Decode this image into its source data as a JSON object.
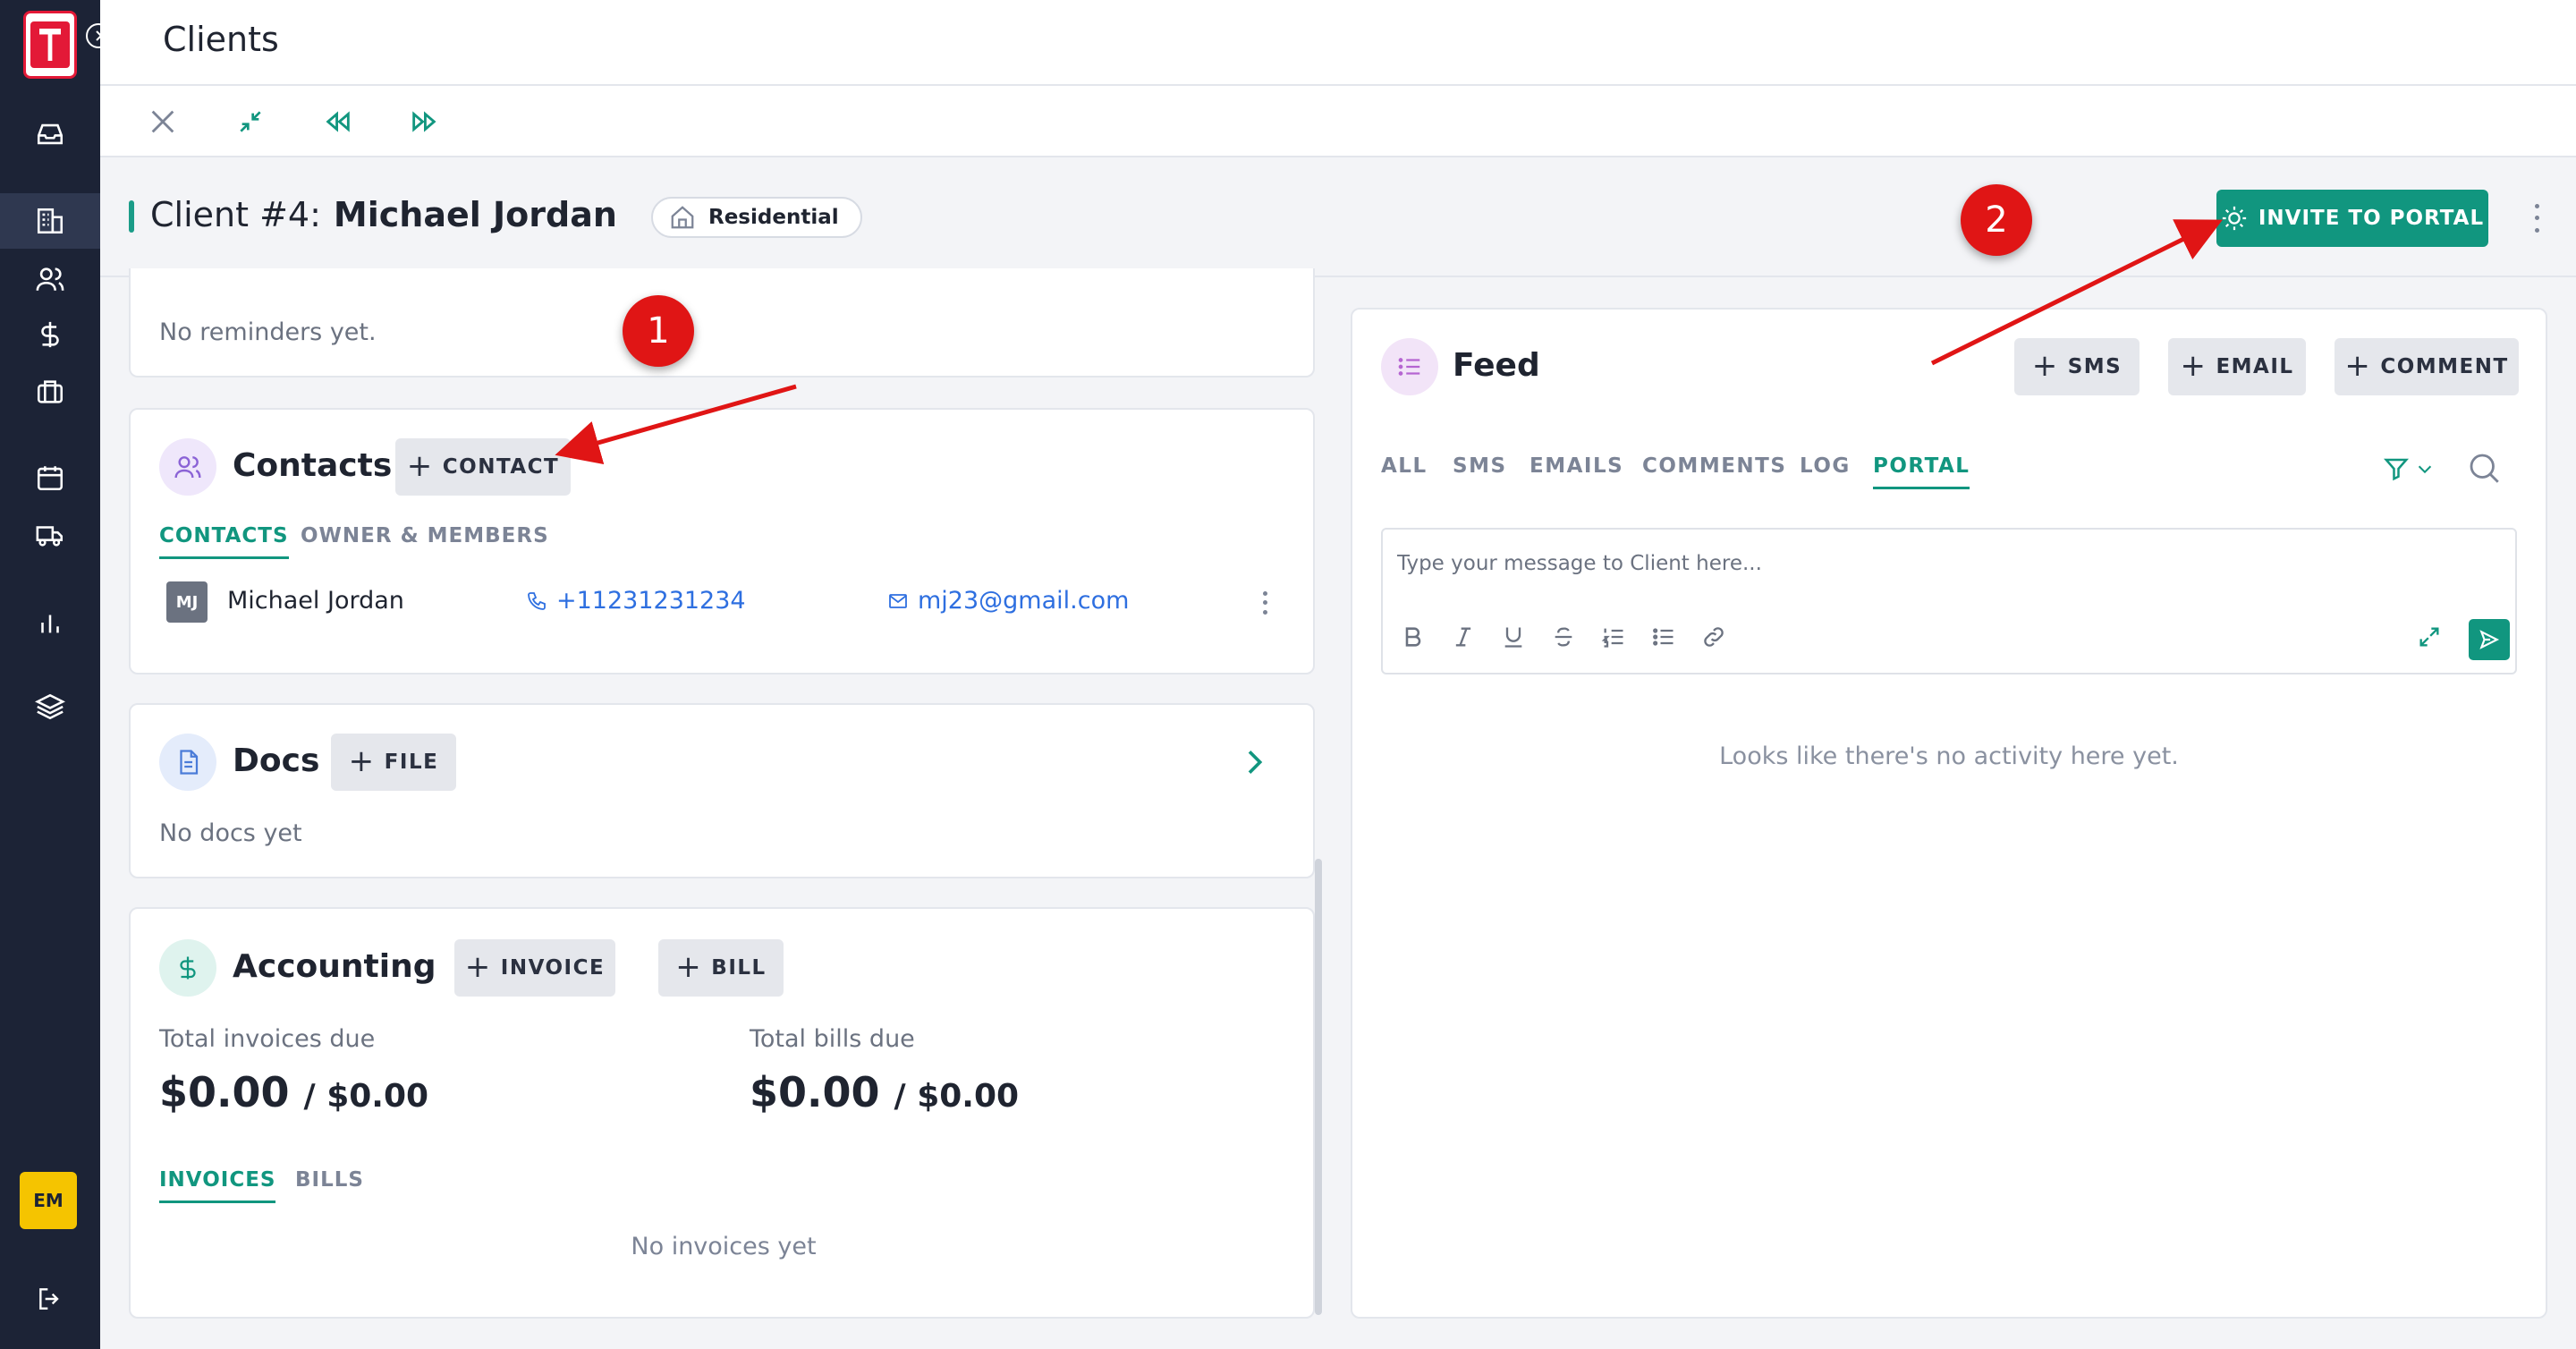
{
  "topbar": {
    "title": "Clients"
  },
  "sidebar": {
    "user_initials": "EM"
  },
  "header": {
    "client_prefix": "Client #4:",
    "client_name": "Michael Jordan",
    "type_badge": "Residential",
    "invite_label": "INVITE TO PORTAL"
  },
  "reminders": {
    "empty_text": "No reminders yet."
  },
  "contacts": {
    "title": "Contacts",
    "add_label": "CONTACT",
    "tabs": [
      "CONTACTS",
      "OWNER & MEMBERS"
    ],
    "rows": [
      {
        "initials": "MJ",
        "name": "Michael Jordan",
        "phone": "+11231231234",
        "email": "mj23@gmail.com"
      }
    ]
  },
  "docs": {
    "title": "Docs",
    "add_label": "FILE",
    "empty_text": "No docs yet"
  },
  "accounting": {
    "title": "Accounting",
    "invoice_label": "INVOICE",
    "bill_label": "BILL",
    "invoices_due_label": "Total invoices due",
    "invoices_due_value": "$0.00",
    "invoices_due_total": "/ $0.00",
    "bills_due_label": "Total bills due",
    "bills_due_value": "$0.00",
    "bills_due_total": "/ $0.00",
    "tabs": [
      "INVOICES",
      "BILLS"
    ],
    "empty_text": "No invoices yet"
  },
  "feed": {
    "title": "Feed",
    "sms_label": "SMS",
    "email_label": "EMAIL",
    "comment_label": "COMMENT",
    "tabs": [
      "ALL",
      "SMS",
      "EMAILS",
      "COMMENTS",
      "LOG",
      "PORTAL"
    ],
    "active_tab": "PORTAL",
    "composer_placeholder": "Type your message to Client here...",
    "empty_text": "Looks like there's no activity here yet."
  },
  "annotations": [
    "1",
    "2"
  ],
  "colors": {
    "accent": "#11967f",
    "sidebar": "#1c2336",
    "annotation": "#e01515",
    "link": "#2e6fe0"
  }
}
